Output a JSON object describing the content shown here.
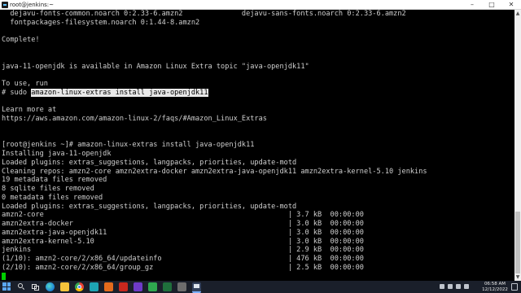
{
  "window": {
    "title": "root@jenkins:~",
    "minimize_glyph": "–",
    "maximize_glyph": "□",
    "close_glyph": "✕"
  },
  "terminal": {
    "lines": [
      "  dejavu-fonts-common.noarch 0:2.33-6.amzn2              dejavu-sans-fonts.noarch 0:2.33-6.amzn2",
      "  fontpackages-filesystem.noarch 0:1.44-8.amzn2",
      "",
      "Complete!",
      "",
      "",
      "java-11-openjdk is available in Amazon Linux Extra topic \"java-openjdk11\"",
      "",
      "To use, run",
      "# sudo amazon-linux-extras install java-openjdk11",
      "",
      "Learn more at",
      "https://aws.amazon.com/amazon-linux-2/faqs/#Amazon_Linux_Extras",
      "",
      "",
      "[root@jenkins ~]# amazon-linux-extras install java-openjdk11",
      "Installing java-11-openjdk",
      "Loaded plugins: extras_suggestions, langpacks, priorities, update-motd",
      "Cleaning repos: amzn2-core amzn2extra-docker amzn2extra-java-openjdk11 amzn2extra-kernel-5.10 jenkins",
      "19 metadata files removed",
      "8 sqlite files removed",
      "0 metadata files removed",
      "Loaded plugins: extras_suggestions, langpacks, priorities, update-motd",
      "amzn2-core                                                          | 3.7 kB  00:00:00",
      "amzn2extra-docker                                                   | 3.0 kB  00:00:00",
      "amzn2extra-java-openjdk11                                           | 3.0 kB  00:00:00",
      "amzn2extra-kernel-5.10                                              | 3.0 kB  00:00:00",
      "jenkins                                                             | 2.9 kB  00:00:00",
      "(1/10): amzn2-core/2/x86_64/updateinfo                              | 476 kB  00:00:00",
      "(2/10): amzn2-core/2/x86_64/group_gz                                | 2.5 kB  00:00:00",
      ""
    ],
    "selected_text": "amazon-linux-extras install java-openjdk11",
    "selected_prefix": "# sudo ",
    "cursor_color": "#00d000",
    "background_color": "#000000",
    "foreground_color": "#cfcfcf"
  },
  "scrollbar": {
    "up_glyph": "▲",
    "down_glyph": "▼"
  },
  "taskbar": {
    "clock_time": "06:58 AM",
    "clock_date": "12/12/2022",
    "icons": [
      "windows-logo",
      "search-icon",
      "task-view-icon",
      "edge-icon",
      "file-explorer-icon",
      "chrome-icon",
      "app-icon",
      "app-icon",
      "app-icon",
      "app-icon",
      "app-icon",
      "app-icon",
      "app-icon",
      "putty-icon"
    ]
  }
}
